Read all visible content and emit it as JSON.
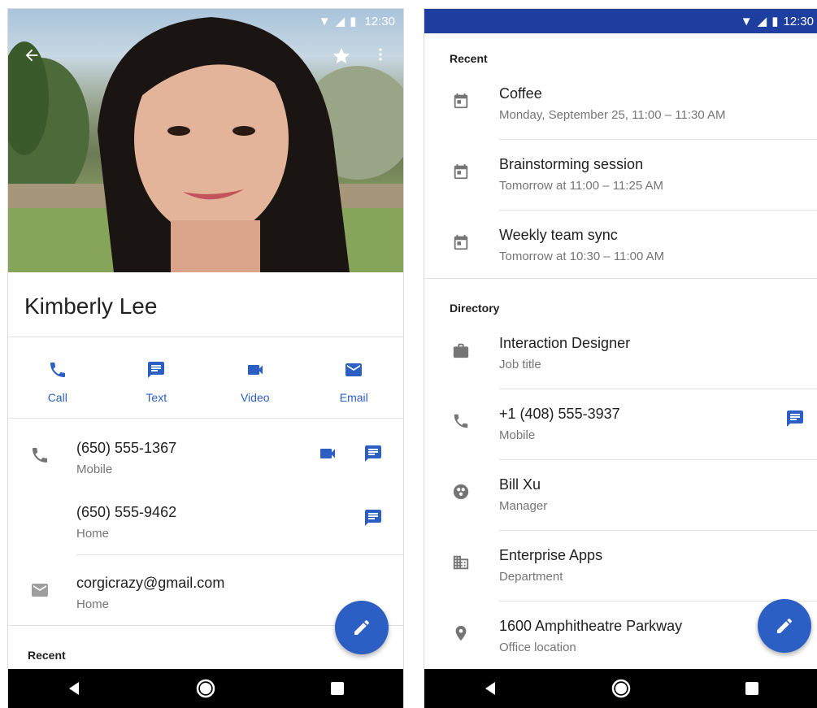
{
  "colors": {
    "accent": "#2c5fc4",
    "status_blue": "#1f3fa0",
    "icon_grey": "#757575"
  },
  "left": {
    "status": {
      "time": "12:30"
    },
    "contact": {
      "name": "Kimberly Lee"
    },
    "actions": [
      {
        "label": "Call",
        "icon": "phone-icon"
      },
      {
        "label": "Text",
        "icon": "message-icon"
      },
      {
        "label": "Video",
        "icon": "video-icon"
      },
      {
        "label": "Email",
        "icon": "email-icon"
      }
    ],
    "phones": [
      {
        "number": "(650) 555-1367",
        "type": "Mobile"
      },
      {
        "number": "(650) 555-9462",
        "type": "Home"
      }
    ],
    "email": {
      "address": "corgicrazy@gmail.com",
      "type": "Home"
    },
    "recent_heading": "Recent"
  },
  "right": {
    "status": {
      "time": "12:30"
    },
    "recent_heading": "Recent",
    "recent": [
      {
        "title": "Coffee",
        "subtitle": "Monday, September 25, 11:00 – 11:30 AM"
      },
      {
        "title": "Brainstorming session",
        "subtitle": "Tomorrow at 11:00 – 11:25 AM"
      },
      {
        "title": "Weekly team sync",
        "subtitle": "Tomorrow at 10:30 – 11:00 AM"
      }
    ],
    "directory_heading": "Directory",
    "directory": [
      {
        "title": "Interaction Designer",
        "subtitle": "Job title",
        "icon": "briefcase-icon"
      },
      {
        "title": "+1 (408) 555-3937",
        "subtitle": "Mobile",
        "icon": "phone-icon"
      },
      {
        "title": "Bill Xu",
        "subtitle": "Manager",
        "icon": "people-icon"
      },
      {
        "title": "Enterprise Apps",
        "subtitle": "Department",
        "icon": "building-icon"
      },
      {
        "title": "1600 Amphitheatre Parkway",
        "subtitle": "Office location",
        "icon": "location-icon"
      }
    ]
  }
}
